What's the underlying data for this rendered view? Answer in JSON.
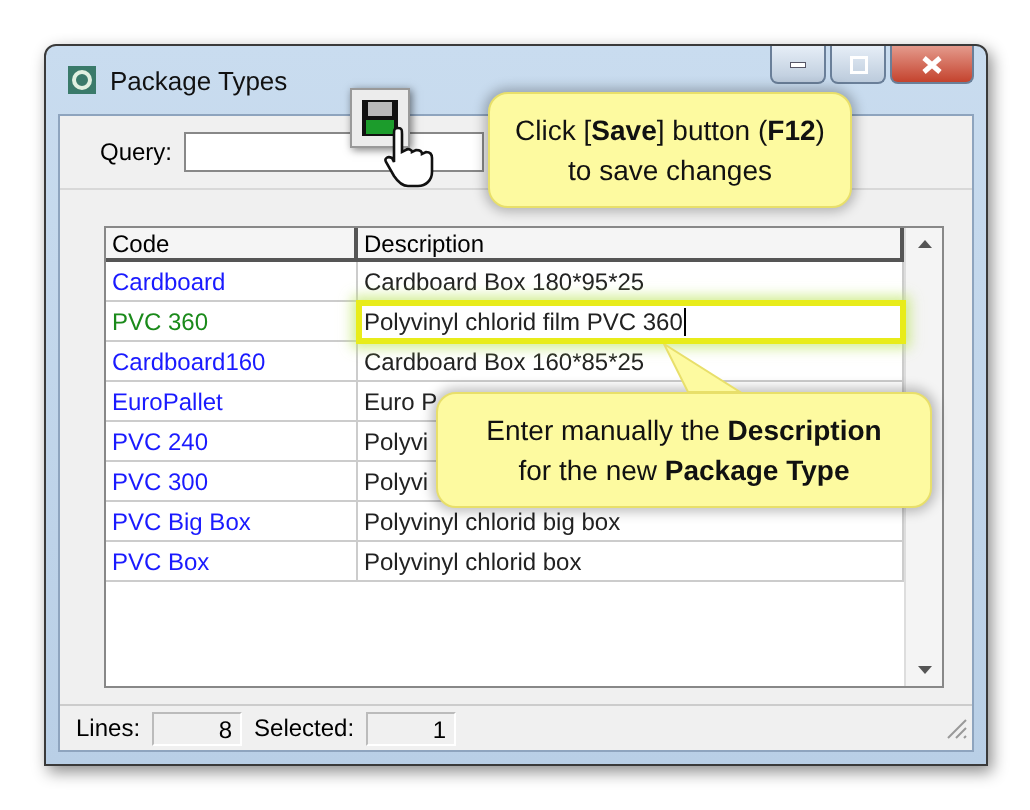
{
  "window": {
    "title": "Package Types"
  },
  "query": {
    "label": "Query:"
  },
  "save_callout": {
    "lines": [
      "Click [**Save**] button (**F12**)",
      "to save changes"
    ]
  },
  "table": {
    "columns": [
      "Code",
      "Description"
    ],
    "rows": [
      {
        "code": "Cardboard",
        "color": "#1a1aff",
        "description": "Cardboard Box 180*95*25",
        "editing": false
      },
      {
        "code": "PVC 360",
        "color": "#1a8a1a",
        "description": "Polyvinyl chlorid film PVC 360",
        "editing": true
      },
      {
        "code": "Cardboard160",
        "color": "#1a1aff",
        "description": "Cardboard Box 160*85*25",
        "editing": false
      },
      {
        "code": "EuroPallet",
        "color": "#1a1aff",
        "description": "Euro P",
        "editing": false
      },
      {
        "code": "PVC 240",
        "color": "#1a1aff",
        "description": "Polyvi",
        "editing": false
      },
      {
        "code": "PVC 300",
        "color": "#1a1aff",
        "description": "Polyvi",
        "editing": false
      },
      {
        "code": "PVC Big Box",
        "color": "#1a1aff",
        "description": "Polyvinyl chlorid big box",
        "editing": false
      },
      {
        "code": "PVC Box",
        "color": "#1a1aff",
        "description": "Polyvinyl chlorid box",
        "editing": false
      }
    ]
  },
  "edit_callout": {
    "lines": [
      "Enter manually the **Description**",
      "for the new **Package Type**"
    ]
  },
  "status_bar": {
    "lines_label": "Lines:",
    "lines_value": "8",
    "selected_label": "Selected:",
    "selected_value": "1"
  }
}
